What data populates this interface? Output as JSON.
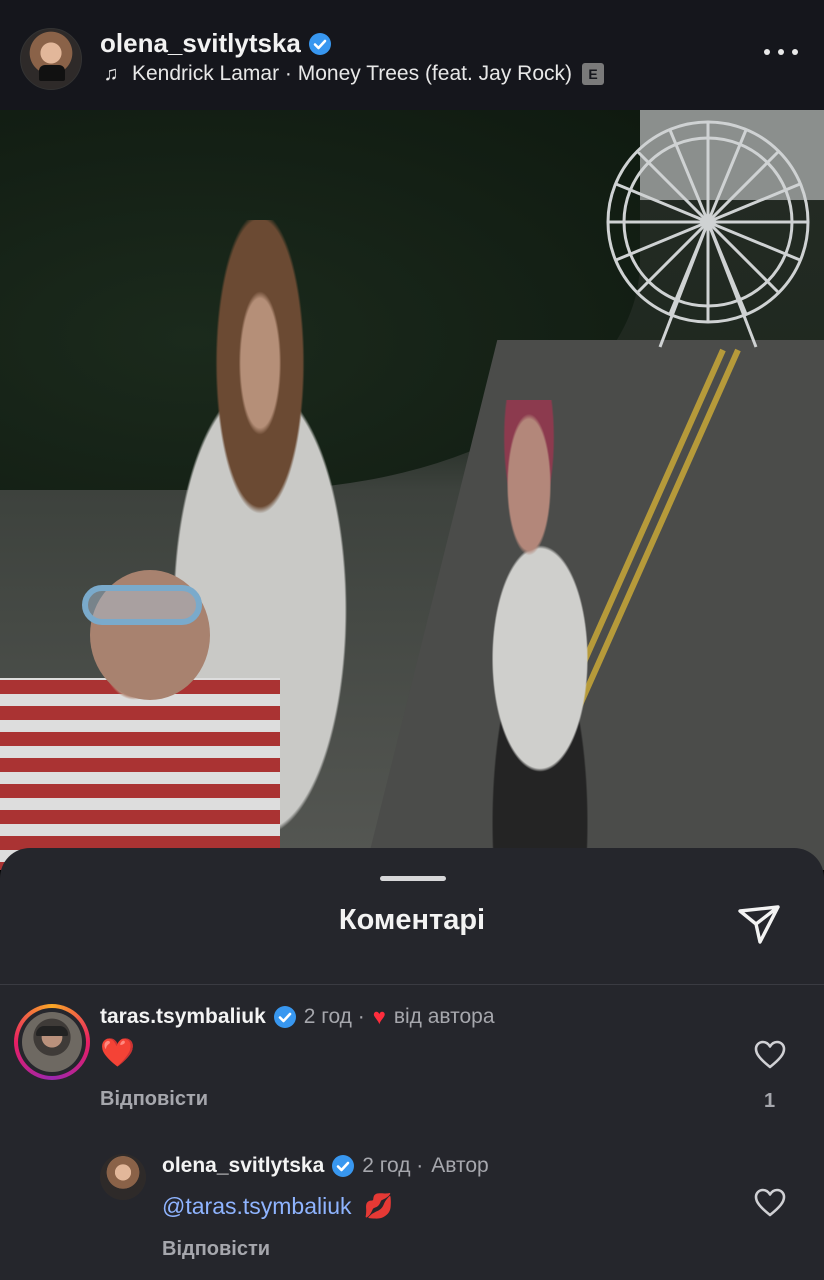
{
  "post": {
    "username": "olena_svitlytska",
    "song": "Kendrick Lamar · Money Trees (feat. Jay Rock)",
    "explicit_badge": "E"
  },
  "comments_sheet": {
    "title": "Коментарі",
    "comments": [
      {
        "username": "taras.tsymbaliuk",
        "time": "2 год ·",
        "badge_text": "від автора",
        "text": "❤️",
        "reply_label": "Відповісти",
        "likes": "1"
      },
      {
        "username": "olena_svitlytska",
        "time": "2 год ·",
        "badge_text": "Автор",
        "text": "@taras.tsymbaliuk",
        "emoji": "💋",
        "reply_label": "Відповісти"
      }
    ]
  },
  "colors": {
    "verified_blue": "#3897f0",
    "heart_red": "#ff2d3d",
    "mention_blue": "#8fb4ff",
    "sheet_bg": "#25262c",
    "header_bg": "#15161c"
  },
  "icons": [
    "music-note-icon",
    "verified-icon",
    "explicit-icon",
    "more-icon",
    "send-icon",
    "heart-icon",
    "like-icon"
  ]
}
